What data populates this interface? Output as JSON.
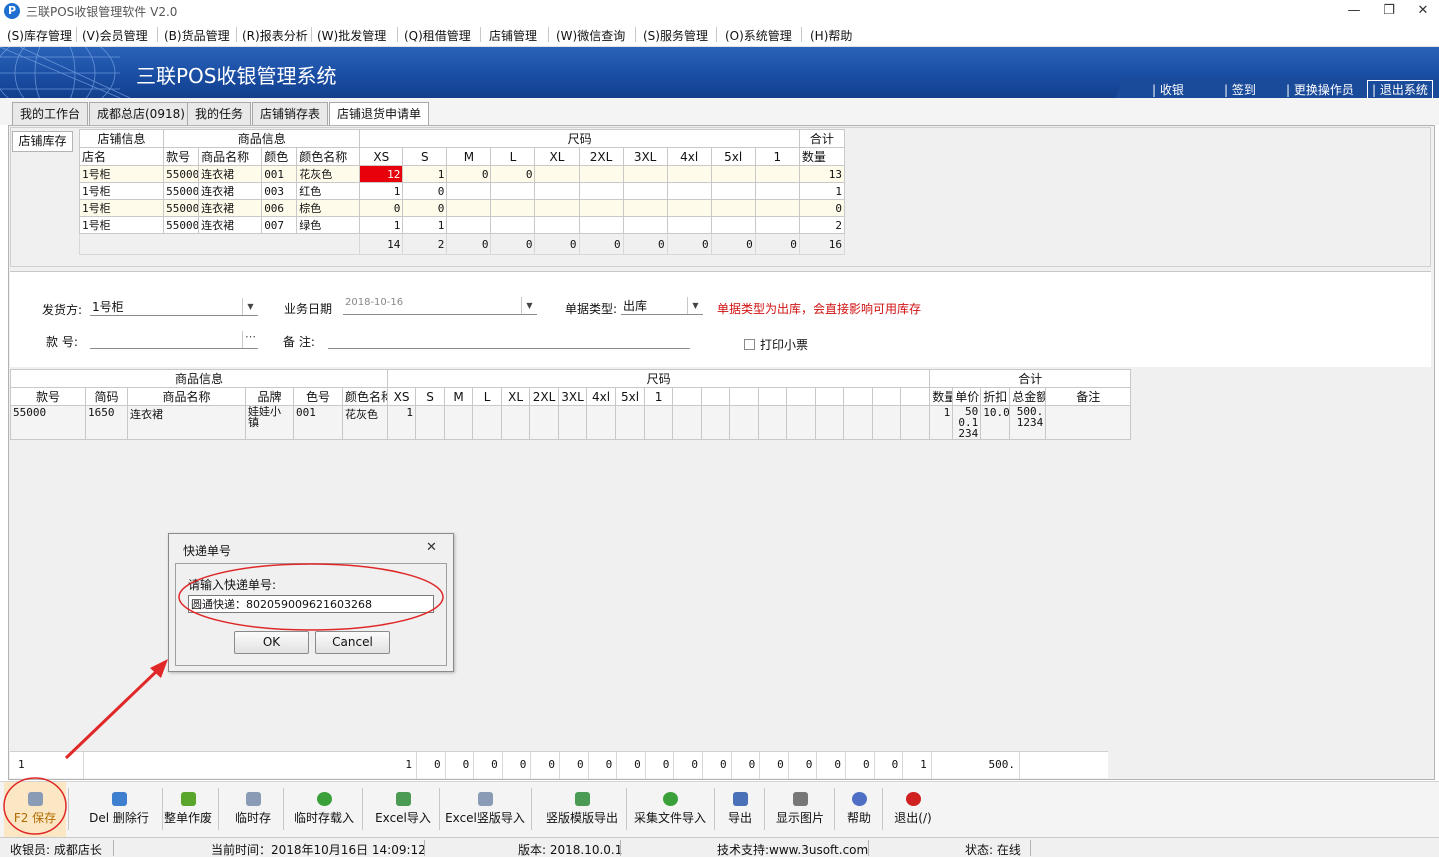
{
  "window": {
    "title": "三联POS收银管理软件 V2.0",
    "icon": "app-logo-icon"
  },
  "menu": [
    "(S)库存管理",
    "(V)会员管理",
    "(B)货品管理",
    "(R)报表分析",
    "(W)批发管理",
    "(Q)租借管理",
    "店铺管理",
    "(W)微信查询",
    "(S)服务管理",
    "(O)系统管理",
    "(H)帮助"
  ],
  "banner": {
    "title": "三联POS收银管理系统",
    "links": [
      "收银",
      "签到",
      "更换操作员",
      "退出系统"
    ]
  },
  "tabs": [
    "我的工作台",
    "成都总店(0918)",
    "我的任务",
    "店铺销存表",
    "店铺退货申请单"
  ],
  "stock": {
    "tab_label": "店铺库存",
    "groups": [
      "店铺信息",
      "商品信息",
      "尺码",
      "合计"
    ],
    "columns": [
      "店名",
      "款号",
      "商品名称",
      "颜色",
      "颜色名称",
      "XS",
      "S",
      "M",
      "L",
      "XL",
      "2XL",
      "3XL",
      "4xl",
      "5xl",
      "1",
      "数量"
    ],
    "rows": [
      [
        "1号柜",
        "55000",
        "连衣裙",
        "001",
        "花灰色",
        "12",
        "1",
        "0",
        "0",
        "",
        "",
        "",
        "",
        "",
        "",
        "13"
      ],
      [
        "1号柜",
        "55000",
        "连衣裙",
        "003",
        "红色",
        "1",
        "0",
        "",
        "",
        "",
        "",
        "",
        "",
        "",
        "",
        "1"
      ],
      [
        "1号柜",
        "55000",
        "连衣裙",
        "006",
        "棕色",
        "0",
        "0",
        "",
        "",
        "",
        "",
        "",
        "",
        "",
        "",
        "0"
      ],
      [
        "1号柜",
        "55000",
        "连衣裙",
        "007",
        "绿色",
        "1",
        "1",
        "",
        "",
        "",
        "",
        "",
        "",
        "",
        "",
        "2"
      ]
    ],
    "totals": [
      "14",
      "2",
      "0",
      "0",
      "0",
      "0",
      "0",
      "0",
      "0",
      "0",
      "16"
    ]
  },
  "form": {
    "sender_label": "发货方:",
    "sender_value": "1号柜",
    "date_label": "业务日期",
    "date_value": "2018-10-16",
    "doc_type_label": "单据类型:",
    "doc_type_value": "出库",
    "warning": "单据类型为出库，会直接影响可用库存",
    "style_label": "款  号:",
    "style_value": "",
    "note_label": "备  注:",
    "note_value": "",
    "print_label": "打印小票"
  },
  "detail": {
    "groups": [
      "商品信息",
      "尺码",
      "合计"
    ],
    "columns": [
      "款号",
      "简码",
      "商品名称",
      "品牌",
      "色号",
      "颜色名称",
      "XS",
      "S",
      "M",
      "L",
      "XL",
      "2XL",
      "3XL",
      "4xl",
      "5xl",
      "1",
      "",
      "",
      "",
      "",
      "",
      "",
      "",
      "",
      "",
      "数量",
      "单价",
      "折扣",
      "总金额",
      "备注"
    ],
    "rows": [
      [
        "55000",
        "1650",
        "连衣裙",
        "娃娃小镇",
        "001",
        "花灰色",
        "1",
        "",
        "",
        "",
        "",
        "",
        "",
        "",
        "",
        "",
        "",
        "",
        "",
        "",
        "",
        "",
        "",
        "",
        "",
        "1",
        "500.1234",
        "10.0",
        "500.1234",
        ""
      ]
    ]
  },
  "footer": {
    "row_count": "1",
    "values": [
      "1",
      "0",
      "0",
      "0",
      "0",
      "0",
      "0",
      "0",
      "0",
      "0",
      "0",
      "0",
      "0",
      "0",
      "0",
      "0",
      "0",
      "0",
      "1"
    ],
    "amount": "500."
  },
  "toolbar": [
    {
      "label": "F2 保存",
      "icon": "save-icon",
      "color": "#8a9bb5"
    },
    {
      "label": "Del 删除行",
      "icon": "delete-row-icon",
      "color": "#3e7fd0"
    },
    {
      "label": "整单作废",
      "icon": "void-basket-icon",
      "color": "#5aa52c"
    },
    {
      "label": "临时存",
      "icon": "temp-save-icon",
      "color": "#8a9bb5"
    },
    {
      "label": "临时存载入",
      "icon": "load-icon",
      "color": "#3aa13a"
    },
    {
      "label": "Excel导入",
      "icon": "excel-import-icon",
      "color": "#4b9b55"
    },
    {
      "label": "Excel竖版导入",
      "icon": "excel-vertical-import-icon",
      "color": "#8a9bb5"
    },
    {
      "label": "竖版模版导出",
      "icon": "template-export-icon",
      "color": "#4b9b55"
    },
    {
      "label": "采集文件导入",
      "icon": "collect-import-icon",
      "color": "#3aa13a"
    },
    {
      "label": "导出",
      "icon": "export-icon",
      "color": "#4a70b8"
    },
    {
      "label": "显示图片",
      "icon": "image-icon",
      "color": "#777777"
    },
    {
      "label": "帮助",
      "icon": "help-icon",
      "color": "#4f6fc4"
    },
    {
      "label": "退出(/)",
      "icon": "exit-icon",
      "color": "#d02020"
    }
  ],
  "status": {
    "cashier": "收银员: 成都店长",
    "time": "当前时间：2018年10月16日 14:09:12",
    "version": "版本: 2018.10.0.1",
    "support": "技术支持:www.3usoft.com",
    "state": "状态: 在线"
  },
  "dialog": {
    "title": "快递单号",
    "prompt": "请输入快递单号:",
    "input_value": "圆通快递：802059009621603268",
    "ok_label": "OK",
    "cancel_label": "Cancel"
  }
}
